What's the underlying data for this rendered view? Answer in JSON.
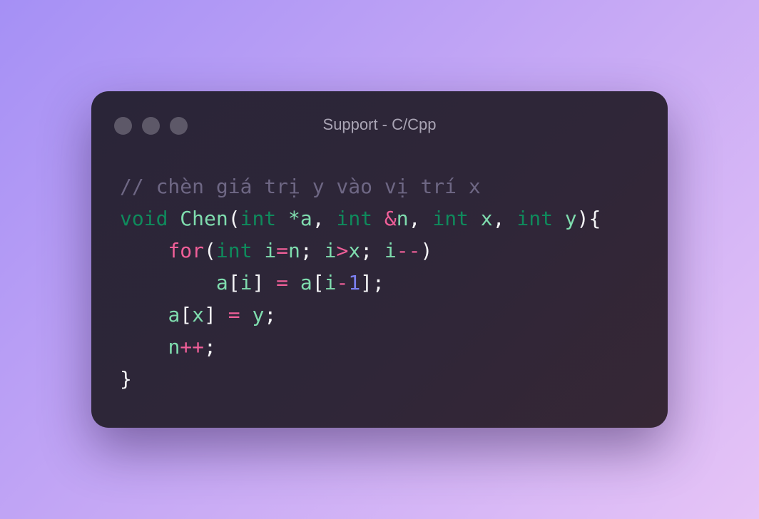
{
  "window": {
    "title": "Support - C/Cpp",
    "buttons": [
      "close",
      "minimize",
      "maximize"
    ]
  },
  "colors": {
    "comment": "#6e6784",
    "keyword": "#0f8a5c",
    "identifier": "#7fdcae",
    "operator": "#ef5f98",
    "number": "#7b7ff0",
    "plain": "#f4f4f6"
  },
  "code": {
    "language": "C/Cpp",
    "lines": [
      [
        [
          "comment",
          "// chèn giá trị y vào vị trí x"
        ]
      ],
      [
        [
          "kw",
          "void"
        ],
        [
          "pl",
          " "
        ],
        [
          "fn",
          "Chen"
        ],
        [
          "pl",
          "("
        ],
        [
          "kw",
          "int"
        ],
        [
          "pl",
          " "
        ],
        [
          "id",
          "*a"
        ],
        [
          "pl",
          ", "
        ],
        [
          "kw",
          "int"
        ],
        [
          "pl",
          " "
        ],
        [
          "op",
          "&"
        ],
        [
          "id",
          "n"
        ],
        [
          "pl",
          ", "
        ],
        [
          "kw",
          "int"
        ],
        [
          "pl",
          " "
        ],
        [
          "id",
          "x"
        ],
        [
          "pl",
          ", "
        ],
        [
          "kw",
          "int"
        ],
        [
          "pl",
          " "
        ],
        [
          "id",
          "y"
        ],
        [
          "pl",
          "){"
        ]
      ],
      [
        [
          "pl",
          "    "
        ],
        [
          "op",
          "for"
        ],
        [
          "pl",
          "("
        ],
        [
          "kw",
          "int"
        ],
        [
          "pl",
          " "
        ],
        [
          "id",
          "i"
        ],
        [
          "op",
          "="
        ],
        [
          "id",
          "n"
        ],
        [
          "pl",
          "; "
        ],
        [
          "id",
          "i"
        ],
        [
          "op",
          ">"
        ],
        [
          "id",
          "x"
        ],
        [
          "pl",
          "; "
        ],
        [
          "id",
          "i"
        ],
        [
          "op",
          "--"
        ],
        [
          "pl",
          ")"
        ]
      ],
      [
        [
          "pl",
          "        "
        ],
        [
          "id",
          "a"
        ],
        [
          "pl",
          "["
        ],
        [
          "id",
          "i"
        ],
        [
          "pl",
          "] "
        ],
        [
          "op",
          "="
        ],
        [
          "pl",
          " "
        ],
        [
          "id",
          "a"
        ],
        [
          "pl",
          "["
        ],
        [
          "id",
          "i"
        ],
        [
          "op",
          "-"
        ],
        [
          "num",
          "1"
        ],
        [
          "pl",
          "];"
        ]
      ],
      [
        [
          "pl",
          "    "
        ],
        [
          "id",
          "a"
        ],
        [
          "pl",
          "["
        ],
        [
          "id",
          "x"
        ],
        [
          "pl",
          "] "
        ],
        [
          "op",
          "="
        ],
        [
          "pl",
          " "
        ],
        [
          "id",
          "y"
        ],
        [
          "pl",
          ";"
        ]
      ],
      [
        [
          "pl",
          "    "
        ],
        [
          "id",
          "n"
        ],
        [
          "op",
          "++"
        ],
        [
          "pl",
          ";"
        ]
      ],
      [
        [
          "pl",
          "}"
        ]
      ]
    ]
  }
}
